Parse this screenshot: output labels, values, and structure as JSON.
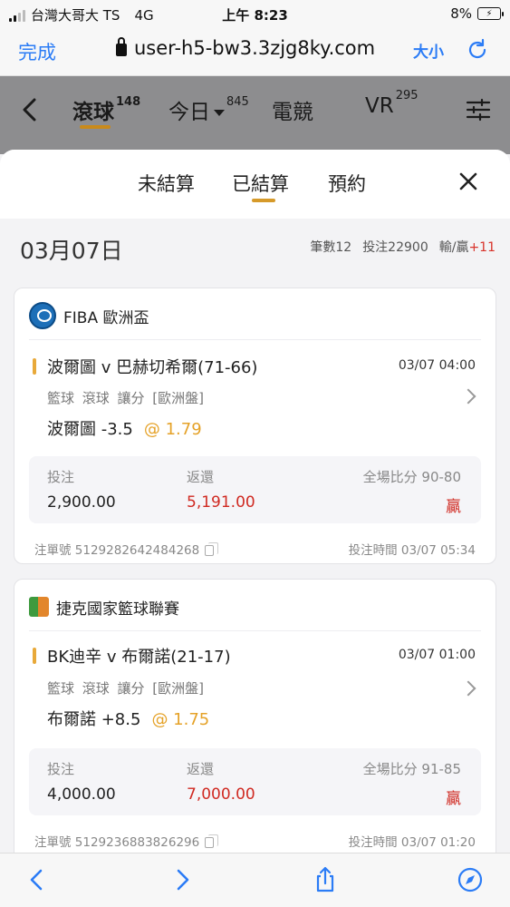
{
  "status": {
    "carrier": "台灣大哥大 TS",
    "network": "4G",
    "time": "上午 8:23",
    "battery": "8%"
  },
  "browser": {
    "done_label": "完成",
    "url": "user-h5-bw3.3zjg8ky.com",
    "text_size_label": "大小"
  },
  "app_tabs": [
    {
      "label": "滾球",
      "count": "148"
    },
    {
      "label": "今日",
      "count": "845"
    },
    {
      "label": "電競",
      "count": ""
    },
    {
      "label": "VR",
      "count": "295"
    }
  ],
  "sheet": {
    "tabs": [
      "未結算",
      "已結算",
      "預約"
    ],
    "active_tab": "已結算",
    "date": "03月07日",
    "count_label": "筆數12",
    "stake_label": "投注22900",
    "winloss_label": "輸/贏",
    "winloss_value": "+11"
  },
  "bets": [
    {
      "league": "FIBA 歐洲盃",
      "match": "波爾圖 v 巴赫切希爾(71-66)",
      "match_time": "03/07 04:00",
      "meta": "籃球 滾球 讓分 [歐洲盤]",
      "pick": "波爾圖 -3.5",
      "odds": "@ 1.79",
      "stake_label": "投注",
      "stake": "2,900.00",
      "return_label": "返還",
      "return": "5,191.00",
      "score_label": "全場比分 90-80",
      "result": "贏",
      "order_label": "注單號 5129282642484268",
      "bet_time_label": "投注時間 03/07 05:34"
    },
    {
      "league": "捷克國家籃球聯賽",
      "match": "BK迪辛 v 布爾諾(21-17)",
      "match_time": "03/07 01:00",
      "meta": "籃球 滾球 讓分 [歐洲盤]",
      "pick": "布爾諾 +8.5",
      "odds": "@ 1.75",
      "stake_label": "投注",
      "stake": "4,000.00",
      "return_label": "返還",
      "return": "7,000.00",
      "score_label": "全場比分 91-85",
      "result": "贏",
      "order_label": "注單號 5129236883826296",
      "bet_time_label": "投注時間 03/07 01:20"
    }
  ],
  "colors": {
    "accent": "#d69a2a",
    "link": "#2b7cf6",
    "win": "#d02a22"
  }
}
